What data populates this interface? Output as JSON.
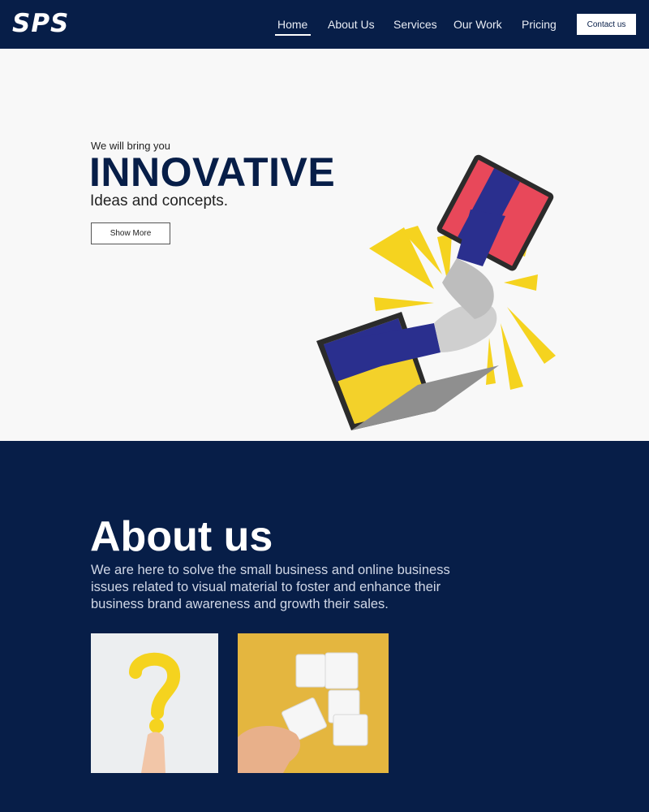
{
  "header": {
    "logo": "SPS",
    "nav": [
      "Home",
      "About Us",
      "Services",
      "Our Work",
      "Pricing"
    ],
    "active_nav": "Home",
    "contact_label": "Contact us"
  },
  "hero": {
    "pre_title": "We will bring you",
    "title": "INNOVATIVE",
    "subtitle": "Ideas and concepts.",
    "button_label": "Show More",
    "image": "handshake-through-laptops-illustration"
  },
  "about": {
    "title": "About us",
    "text": "We are here to solve the small business and online business issues related to visual material to foster and enhance their business brand awareness and growth their sales.",
    "images": [
      "question-mark-in-hand-photo",
      "puzzle-pieces-photo"
    ]
  },
  "colors": {
    "navy": "#071e48",
    "accent_yellow": "#f5d31f",
    "light_bg": "#f8f8f8"
  }
}
